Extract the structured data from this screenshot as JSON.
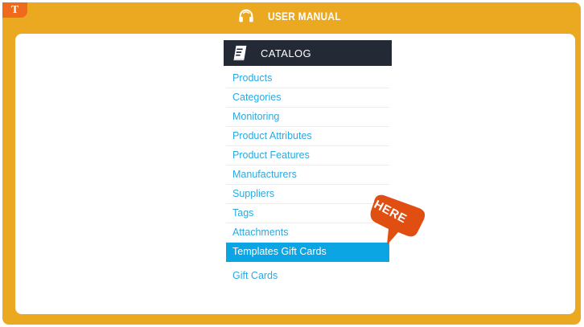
{
  "header": {
    "logo_text": "T",
    "title": "USER MANUAL",
    "icon": "headset-icon"
  },
  "catalog": {
    "title": "CATALOG",
    "icon": "book-icon",
    "items": [
      {
        "label": "Products"
      },
      {
        "label": "Categories"
      },
      {
        "label": "Monitoring"
      },
      {
        "label": "Product Attributes"
      },
      {
        "label": "Product Features"
      },
      {
        "label": "Manufacturers"
      },
      {
        "label": "Suppliers"
      },
      {
        "label": "Tags"
      },
      {
        "label": "Attachments"
      },
      {
        "label": "Templates Gift Cards"
      },
      {
        "label": "Gift Cards"
      }
    ],
    "active_item": "Templates Gift Cards"
  },
  "callout": {
    "text": "HERE",
    "color": "#e04e12"
  },
  "colors": {
    "frame": "#eaa921",
    "menu_link": "#2aa9e0",
    "active_bg": "#0aa5e2",
    "catalog_header_bg": "#232a35"
  }
}
